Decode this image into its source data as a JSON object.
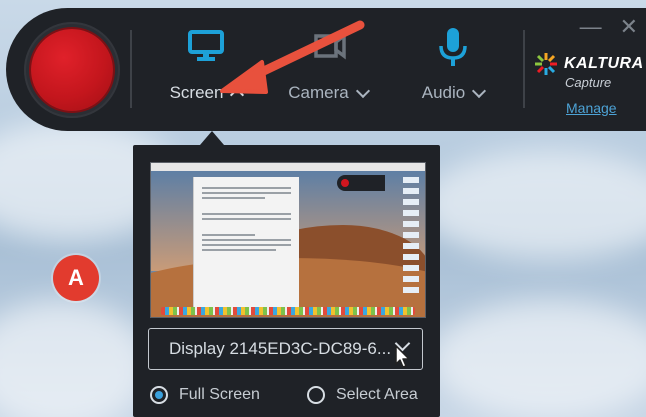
{
  "toolbar": {
    "tools": [
      {
        "label": "Screen",
        "icon": "monitor-icon",
        "state": "open"
      },
      {
        "label": "Camera",
        "icon": "camera-icon"
      },
      {
        "label": "Audio",
        "icon": "microphone-icon"
      }
    ],
    "brand_name": "KALTURA",
    "brand_sub": "Capture",
    "manage_link": "Manage",
    "window_controls": [
      "—",
      "✕"
    ]
  },
  "screen_panel": {
    "display_value": "Display 2145ED3C-DC89-6...",
    "options": [
      {
        "label": "Full Screen",
        "selected": true
      },
      {
        "label": "Select Area",
        "selected": false
      }
    ]
  },
  "annotation": {
    "badge_label": "A"
  },
  "colors": {
    "accent": "#1da1d8",
    "record": "#c4161d",
    "toolbar_bg": "#1f2227",
    "annotation": "#e23b2e"
  }
}
